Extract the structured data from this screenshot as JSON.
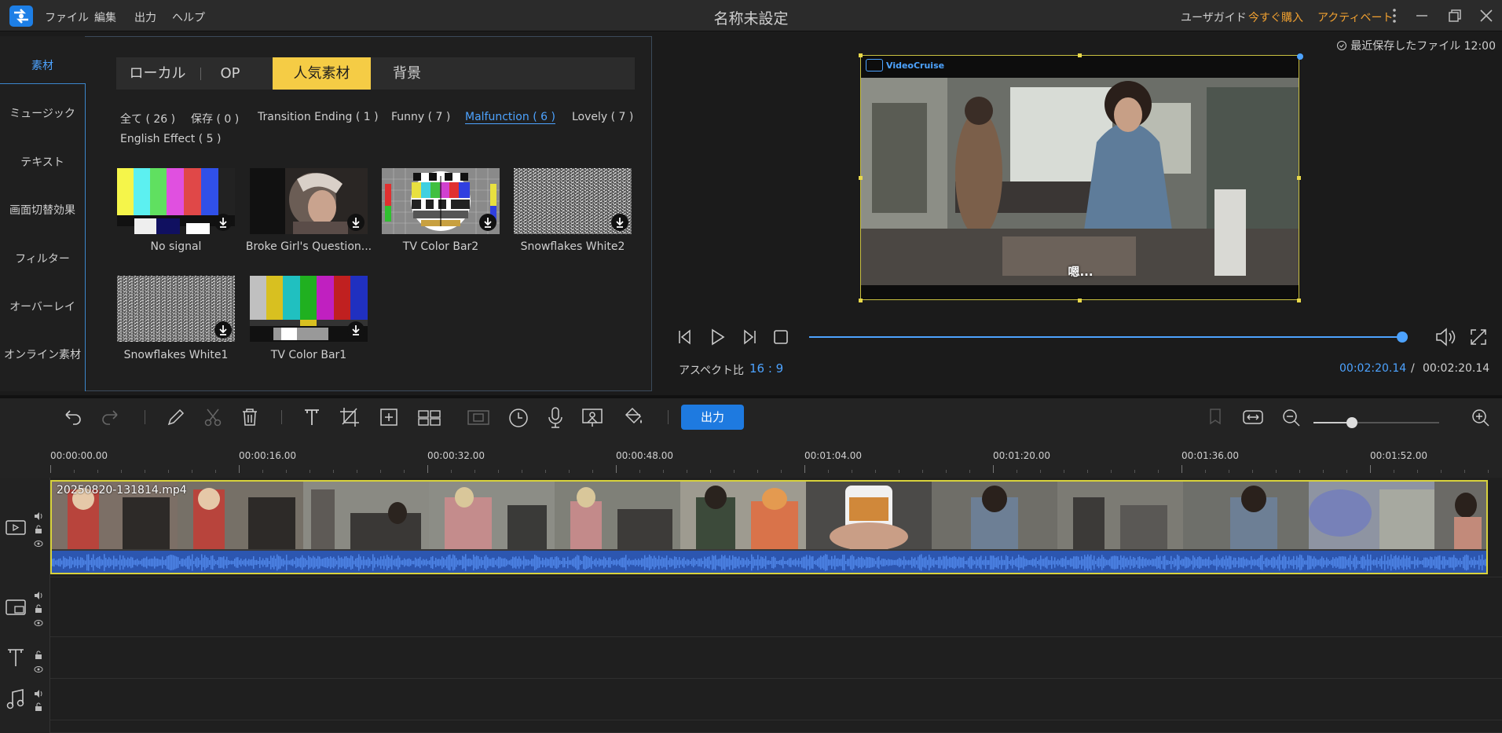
{
  "titlebar": {
    "menus": [
      "ファイル",
      "編集",
      "出力",
      "ヘルプ"
    ],
    "title": "名称未設定",
    "user_guide": "ユーザガイド",
    "buy_now": "今すぐ購入",
    "activate": "アクティベート"
  },
  "left_nav": {
    "items": [
      "素材",
      "ミュージック",
      "テキスト",
      "画面切替効果",
      "フィルター",
      "オーバーレイ",
      "オンライン素材"
    ],
    "active_index": 0
  },
  "tabs": [
    "ローカル",
    "OP",
    "人気素材",
    "背景"
  ],
  "active_tab": "人気素材",
  "filters": [
    "全て ( 26 )",
    "保存 ( 0 )",
    "Transition Ending ( 1 )",
    "Funny ( 7 )",
    "Malfunction ( 6 )",
    "Lovely ( 7 )",
    "English Effect ( 5 )"
  ],
  "active_filter": "Malfunction ( 6 )",
  "materials": [
    {
      "label": "No signal",
      "type": "color-bars"
    },
    {
      "label": "Broke Girl's Question...",
      "type": "photo"
    },
    {
      "label": "TV Color Bar2",
      "type": "test-pattern"
    },
    {
      "label": "Snowflakes White2",
      "type": "static"
    },
    {
      "label": "Snowflakes White1",
      "type": "static"
    },
    {
      "label": "TV Color Bar1",
      "type": "color-bars"
    }
  ],
  "preview": {
    "save_status": "最近保存したファイル 12:00",
    "watermark": "VideoCruise",
    "subtitle": "嗯...",
    "aspect_label": "アスペクト比",
    "aspect_value": "16 : 9",
    "current_time": "00:02:20.14",
    "separator": "/",
    "total_time": "00:02:20.14",
    "progress": 1.0
  },
  "toolbar": {
    "export_label": "出力",
    "zoom_level": 0.55
  },
  "ruler": {
    "labels": [
      "00:00:00.00",
      "00:00:16.00",
      "00:00:32.00",
      "00:00:48.00",
      "00:01:04.00",
      "00:01:20.00",
      "00:01:36.00",
      "00:01:52.00"
    ]
  },
  "timeline": {
    "clip_name": "20250820-131814.mp4"
  },
  "colors": {
    "accent": "#1e7ae0",
    "tab_active": "#f5cc45",
    "link": "#4da3ff",
    "buy": "#f0a030",
    "clip_border": "#d8d23c",
    "waveform": "#4f86e8"
  }
}
